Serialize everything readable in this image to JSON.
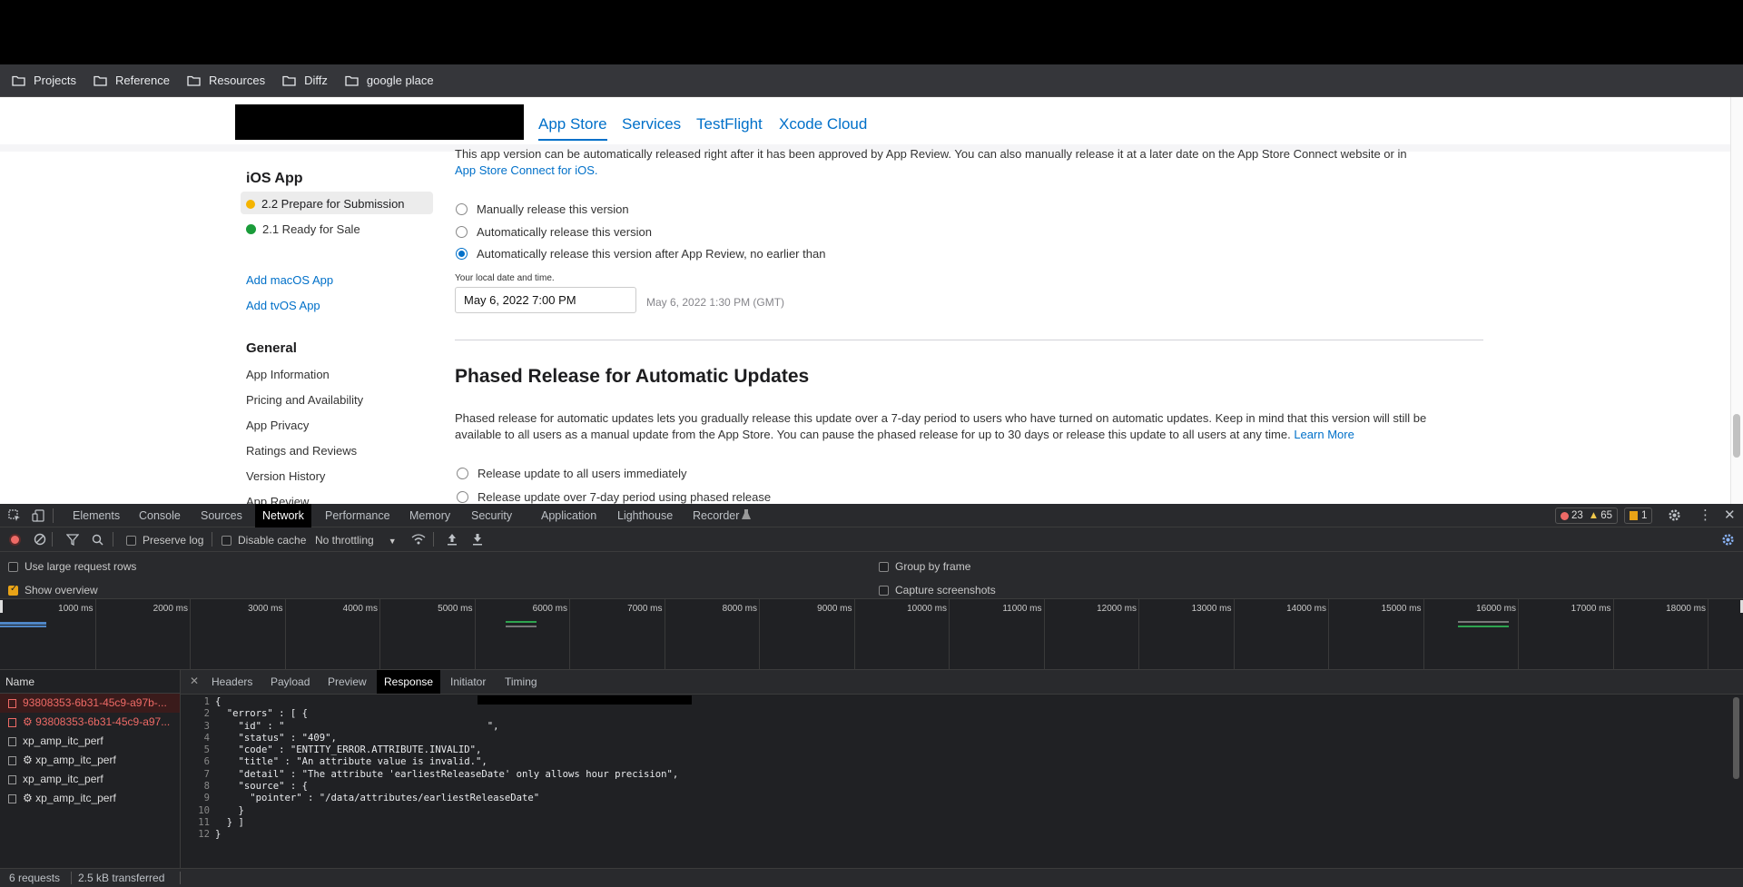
{
  "bookmarks": [
    "Projects",
    "Reference",
    "Resources",
    "Diffz",
    "google place"
  ],
  "nav": {
    "tabs": [
      "App Store",
      "Services",
      "TestFlight",
      "Xcode Cloud"
    ],
    "active": "App Store"
  },
  "sidebar": {
    "ios_heading": "iOS App",
    "versions": [
      {
        "label": "2.2 Prepare for Submission",
        "status_color": "#f5b400"
      },
      {
        "label": "2.1 Ready for Sale",
        "status_color": "#1a9c3a"
      }
    ],
    "add_macos": "Add macOS App",
    "add_tvos": "Add tvOS App",
    "general_heading": "General",
    "general_items": [
      "App Information",
      "Pricing and Availability",
      "App Privacy",
      "Ratings and Reviews",
      "Version History",
      "App Review"
    ]
  },
  "release": {
    "intro": "This app version can be automatically released right after it has been approved by App Review. You can also manually release it at a later date on the App Store Connect website or in",
    "intro_link": "App Store Connect for iOS.",
    "options": [
      {
        "label": "Manually release this version",
        "selected": false
      },
      {
        "label": "Automatically release this version",
        "selected": false
      },
      {
        "label": "Automatically release this version after App Review, no earlier than",
        "selected": true
      }
    ],
    "local_label": "Your local date and time.",
    "date_value": "May 6, 2022 7:00 PM",
    "gmt_value": "May 6, 2022 1:30 PM (GMT)"
  },
  "phased": {
    "title": "Phased Release for Automatic Updates",
    "desc_line1": "Phased release for automatic updates lets you gradually release this update over a 7-day period to users who have turned on automatic updates. Keep in mind that this version will still be",
    "desc_line2": "available to all users as a manual update from the App Store. You can pause the phased release for up to 30 days or release this update to all users at any time.",
    "learn_more": "Learn More",
    "options": [
      {
        "label": "Release update to all users immediately",
        "selected": false
      },
      {
        "label": "Release update over 7-day period using phased release",
        "selected": false
      }
    ]
  },
  "devtools": {
    "tabs": [
      "Elements",
      "Console",
      "Sources",
      "Network",
      "Performance",
      "Memory",
      "Security",
      "Application",
      "Lighthouse",
      "Recorder"
    ],
    "active_tab": "Network",
    "errors": "23",
    "warnings": "65",
    "issues": "1",
    "toolbar": {
      "preserve_log": "Preserve log",
      "disable_cache": "Disable cache",
      "throttling": "No throttling"
    },
    "settings": {
      "large_rows": "Use large request rows",
      "show_overview": "Show overview",
      "group_by_frame": "Group by frame",
      "capture_screenshots": "Capture screenshots"
    },
    "timeline_ticks": [
      "1000 ms",
      "2000 ms",
      "3000 ms",
      "4000 ms",
      "5000 ms",
      "6000 ms",
      "7000 ms",
      "8000 ms",
      "9000 ms",
      "10000 ms",
      "11000 ms",
      "12000 ms",
      "13000 ms",
      "14000 ms",
      "15000 ms",
      "16000 ms",
      "17000 ms",
      "18000 ms"
    ],
    "name_header": "Name",
    "requests": [
      {
        "name": "93808353-6b31-45c9-a97b-...",
        "error": true,
        "selected": true
      },
      {
        "name": "⚙ 93808353-6b31-45c9-a97...",
        "error": true,
        "selected": false
      },
      {
        "name": "xp_amp_itc_perf",
        "error": false,
        "selected": false
      },
      {
        "name": "⚙ xp_amp_itc_perf",
        "error": false,
        "selected": false
      },
      {
        "name": "xp_amp_itc_perf",
        "error": false,
        "selected": false
      },
      {
        "name": "⚙ xp_amp_itc_perf",
        "error": false,
        "selected": false
      }
    ],
    "detail_tabs": [
      "Headers",
      "Payload",
      "Preview",
      "Response",
      "Initiator",
      "Timing"
    ],
    "active_detail": "Response",
    "response_lines": [
      "{",
      "  \"errors\" : [ {",
      "    \"id\" : \"                                   \",",
      "    \"status\" : \"409\",",
      "    \"code\" : \"ENTITY_ERROR.ATTRIBUTE.INVALID\",",
      "    \"title\" : \"An attribute value is invalid.\",",
      "    \"detail\" : \"The attribute 'earliestReleaseDate' only allows hour precision\",",
      "    \"source\" : {",
      "      \"pointer\" : \"/data/attributes/earliestReleaseDate\"",
      "    }",
      "  } ]",
      "}"
    ],
    "status_requests": "6 requests",
    "status_transferred": "2.5 kB transferred"
  }
}
